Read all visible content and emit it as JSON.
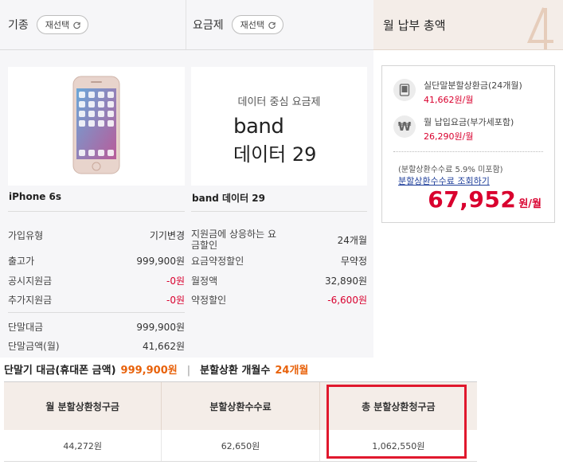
{
  "header": {
    "device_title": "기종",
    "plan_title": "요금제",
    "reselect_label": "재선택",
    "total_title": "월 납부 총액"
  },
  "device": {
    "name": "iPhone 6s",
    "rows": [
      {
        "label": "가입유형",
        "value": "기기변경"
      },
      {
        "label": "출고가",
        "value": "999,900원"
      },
      {
        "label": "공시지원금",
        "value": "-0원"
      },
      {
        "label": "추가지원금",
        "value": "-0원"
      },
      {
        "label": "단말대금",
        "value": "999,900원"
      },
      {
        "label": "단말금액(월)",
        "value": "41,662원"
      }
    ]
  },
  "plan": {
    "tag": "데이터 중심 요금제",
    "image_name_line1": "band",
    "image_name_line2": "데이터 29",
    "name": "band 데이터 29",
    "rows": [
      {
        "label": "지원금에 상응하는 요금할인",
        "value": "24개월"
      },
      {
        "label": "요금약정할인",
        "value": "무약정"
      },
      {
        "label": "월정액",
        "value": "32,890원"
      },
      {
        "label": "약정할인",
        "value": "-6,600원"
      }
    ]
  },
  "summary": {
    "item1_label": "실단말분할상환금(24개월)",
    "item1_value": "41,662원/월",
    "item2_label": "월 납입요금(부가세포함)",
    "item2_value": "26,290원/월",
    "note": "(분할상환수수료 5.9% 미포함)",
    "link": "분할상환수수료 조회하기",
    "total_value": "67,952",
    "total_unit": "원/월"
  },
  "bottom": {
    "price_label": "단말기 대금(휴대폰 금액)",
    "price_value": "999,900원",
    "months_label": "분할상환 개월수",
    "months_value": "24개월",
    "headers": [
      "월 분할상환청구금",
      "분할상환수수료",
      "총 분할상환청구금"
    ],
    "values": [
      "44,272원",
      "62,650원",
      "1,062,550원"
    ]
  },
  "colors": {
    "accent_red": "#d9002e",
    "accent_orange": "#e8620b",
    "highlight": "#e0182d"
  }
}
